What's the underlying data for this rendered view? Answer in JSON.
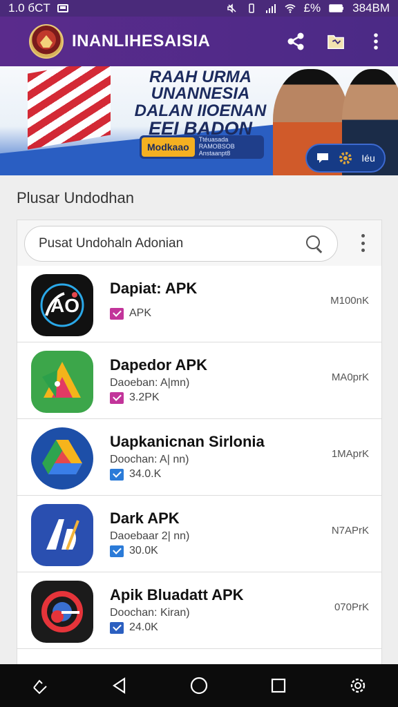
{
  "status_bar": {
    "left_text": "1.0 бСT",
    "right_text": "384BM",
    "battery_text": "£%"
  },
  "app_bar": {
    "title": "INANLIHESAISIA"
  },
  "banner": {
    "line1": "RAAH URMA UNANNESIA",
    "line2": "DALAN IIOENAN",
    "line3": "EEI BADON DAGAATAN!",
    "cta_label": "Modkaao",
    "cta_small_text": "Ttéuasada\nRAMOBSOB\nAnstaanpt8",
    "pill_text": "Iéu"
  },
  "section": {
    "title": "Plusar Undodhan"
  },
  "search": {
    "value": "Pusat Undohaln Adonian"
  },
  "apps": [
    {
      "title": "Dapiat: APK",
      "subtitle": "",
      "badge": "APK",
      "size": "M100nK",
      "check_color": "#c2349a",
      "icon": "ao-icon"
    },
    {
      "title": "Dapedor APK",
      "subtitle": "Daoeban: A|mn)",
      "badge": "3.2PK",
      "size": "MA0prK",
      "check_color": "#c2349a",
      "icon": "android-studio-icon"
    },
    {
      "title": "Uapkanicnan Sirlonia",
      "subtitle": "Doochan: A| nn)",
      "badge": "34.0.K",
      "size": "1MAprK",
      "check_color": "#2b7bd8",
      "icon": "drive-icon"
    },
    {
      "title": "Dark APK",
      "subtitle": "Daoebaar 2| nn)",
      "badge": "30.0K",
      "size": "N7APrK",
      "check_color": "#2b7bd8",
      "icon": "ab-icon"
    },
    {
      "title": "Apik Bluadatt APK",
      "subtitle": "Doochan: Kiran)",
      "badge": "24.0K",
      "size": "070PrK",
      "check_color": "#2b5fc0",
      "icon": "blueadatt-icon"
    }
  ],
  "colors": {
    "app_bar": "#5a2b8c",
    "status_bar": "#4a2a7a",
    "banner_blue": "#2a5ec2",
    "cta_yellow": "#f5b021"
  }
}
